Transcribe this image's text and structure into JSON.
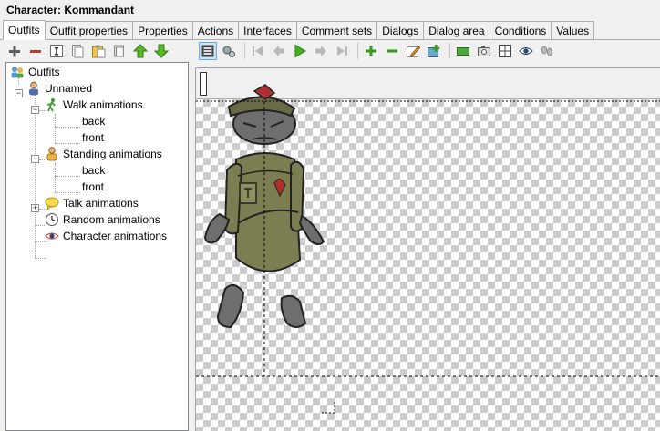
{
  "window": {
    "title": "Character: Kommandant"
  },
  "tabs": [
    {
      "label": "Outfits",
      "active": true
    },
    {
      "label": "Outfit properties"
    },
    {
      "label": "Properties"
    },
    {
      "label": "Actions"
    },
    {
      "label": "Interfaces"
    },
    {
      "label": "Comment sets"
    },
    {
      "label": "Dialogs"
    },
    {
      "label": "Dialog area"
    },
    {
      "label": "Conditions"
    },
    {
      "label": "Values"
    }
  ],
  "left_toolbar": [
    "add-icon",
    "remove-icon",
    "rename-icon",
    "copy-icon",
    "paste-icon",
    "delete-icon",
    "move-up-icon",
    "move-down-icon"
  ],
  "right_toolbar": [
    "frame-view-icon",
    "settings-icon",
    "first-frame-icon",
    "previous-frame-icon",
    "play-icon",
    "next-frame-icon",
    "last-frame-icon",
    "add-frame-icon",
    "remove-frame-icon",
    "edit-frame-icon",
    "import-frame-icon",
    "background-icon",
    "camera-icon",
    "grid-icon",
    "view-eye-icon",
    "footsteps-icon"
  ],
  "tree": {
    "root": "Outfits",
    "outfit": "Unnamed",
    "walk": "Walk animations",
    "walk_back": "back",
    "walk_front": "front",
    "standing": "Standing animations",
    "standing_back": "back",
    "standing_front": "front",
    "talk": "Talk animations",
    "random": "Random animations",
    "character": "Character animations"
  },
  "colors": {
    "selection": "#cce4f7",
    "tab_border": "#adadad",
    "uniform": "#7d7d52",
    "skin": "#6e6e6e"
  }
}
